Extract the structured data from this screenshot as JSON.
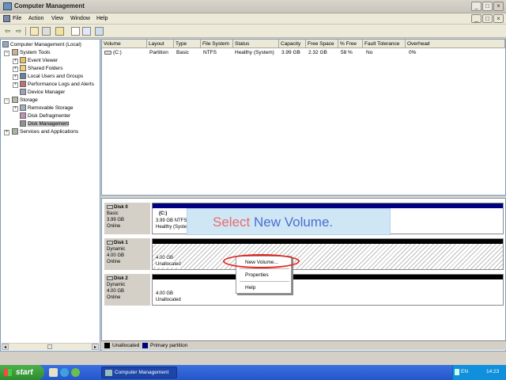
{
  "window": {
    "title": "Computer Management"
  },
  "menu": [
    "File",
    "Action",
    "View",
    "Window",
    "Help"
  ],
  "tree": [
    {
      "label": "Computer Management (Local)",
      "icon": "computer-icon"
    },
    {
      "label": "System Tools",
      "icon": "tools-icon"
    },
    {
      "label": "Event Viewer",
      "icon": "event-viewer-icon"
    },
    {
      "label": "Shared Folders",
      "icon": "shared-folders-icon"
    },
    {
      "label": "Local Users and Groups",
      "icon": "users-icon"
    },
    {
      "label": "Performance Logs and Alerts",
      "icon": "performance-icon"
    },
    {
      "label": "Device Manager",
      "icon": "device-manager-icon"
    },
    {
      "label": "Storage",
      "icon": "storage-icon"
    },
    {
      "label": "Removable Storage",
      "icon": "removable-storage-icon"
    },
    {
      "label": "Disk Defragmenter",
      "icon": "defragmenter-icon"
    },
    {
      "label": "Disk Management",
      "icon": "disk-management-icon"
    },
    {
      "label": "Services and Applications",
      "icon": "services-icon"
    }
  ],
  "volume_list": {
    "columns": [
      "Volume",
      "Layout",
      "Type",
      "File System",
      "Status",
      "Capacity",
      "Free Space",
      "% Free",
      "Fault Tolerance",
      "Overhead"
    ],
    "rows": [
      [
        "(C:)",
        "Partition",
        "Basic",
        "NTFS",
        "Healthy (System)",
        "3.99 GB",
        "2.32 GB",
        "58 %",
        "No",
        "0%"
      ]
    ]
  },
  "disks": [
    {
      "name": "Disk 0",
      "type": "Basic",
      "size": "3.99 GB",
      "status": "Online",
      "volume_name": "(C:)",
      "volume_line": "3.99 GB NTFS",
      "volume_status": "Healthy (System)"
    },
    {
      "name": "Disk 1",
      "type": "Dynamic",
      "size": "4.00 GB",
      "status": "Online",
      "volume_size": "4.00 GB",
      "volume_status": "Unallocated"
    },
    {
      "name": "Disk 2",
      "type": "Dynamic",
      "size": "4.00 GB",
      "status": "Online",
      "volume_size": "4.00 GB",
      "volume_status": "Unallocated"
    }
  ],
  "legend": [
    {
      "label": "Unallocated",
      "color": "#000000"
    },
    {
      "label": "Primary partition",
      "color": "#000080"
    }
  ],
  "annotation": {
    "part1": "Select",
    "part2": "New Volume."
  },
  "context_menu": [
    "New Volume...",
    "Properties",
    "Help"
  ],
  "taskbar": {
    "start": "start",
    "task": "Computer Management",
    "lang": "EN",
    "clock": "14:23"
  },
  "colors": {
    "accent": "#000080",
    "highlight_oval": "#e0241b"
  }
}
